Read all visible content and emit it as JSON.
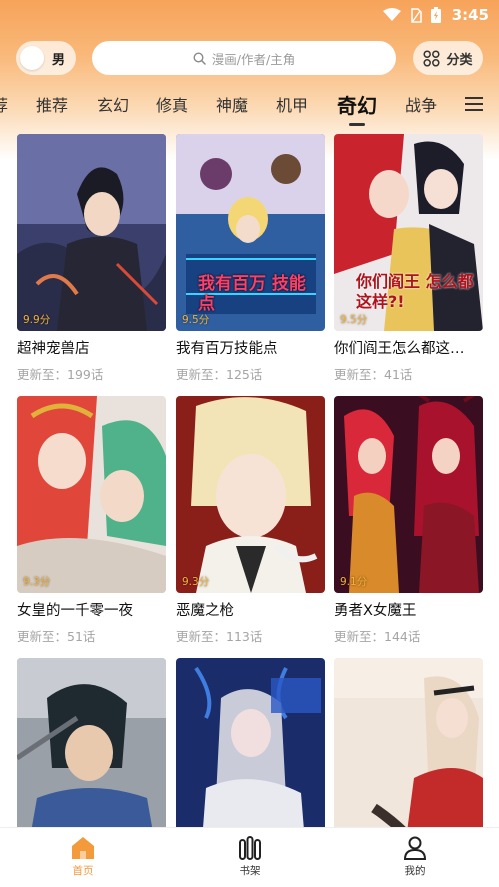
{
  "status_bar": {
    "time": "3:45"
  },
  "header": {
    "gender_label": "男",
    "search_placeholder": "漫画/作者/主角",
    "category_label": "分类"
  },
  "tabs": [
    {
      "label": "荐"
    },
    {
      "label": "推荐"
    },
    {
      "label": "玄幻"
    },
    {
      "label": "修真"
    },
    {
      "label": "神魔"
    },
    {
      "label": "机甲"
    },
    {
      "label": "奇幻",
      "active": true
    },
    {
      "label": "战争"
    }
  ],
  "comics": [
    {
      "title": "超神宠兽店",
      "score": "9.9分",
      "update": "更新至：199话"
    },
    {
      "title": "我有百万技能点",
      "score": "9.5分",
      "update": "更新至：125话"
    },
    {
      "title": "你们阎王怎么都这…",
      "score": "9.5分",
      "update": "更新至：41话"
    },
    {
      "title": "女皇的一千零一夜",
      "score": "9.3分",
      "update": "更新至：51话"
    },
    {
      "title": "恶魔之枪",
      "score": "9.3分",
      "update": "更新至：113话"
    },
    {
      "title": "勇者X女魔王",
      "score": "9.1分",
      "update": "更新至：144话"
    },
    {
      "title": "",
      "score": "",
      "update": ""
    },
    {
      "title": "",
      "score": "",
      "update": ""
    },
    {
      "title": "",
      "score": "",
      "update": ""
    }
  ],
  "cover_art_text": {
    "c2": "我有百万 技能点",
    "c3": "你们阎王 怎么都这样?!"
  },
  "bottom_nav": [
    {
      "label": "首页",
      "icon": "home-icon",
      "active": true
    },
    {
      "label": "书架",
      "icon": "bookshelf-icon"
    },
    {
      "label": "我的",
      "icon": "user-icon"
    }
  ],
  "colors": {
    "accent": "#f39a3b",
    "header_gradient_top": "#f7a35a",
    "score": "#f2b239"
  }
}
